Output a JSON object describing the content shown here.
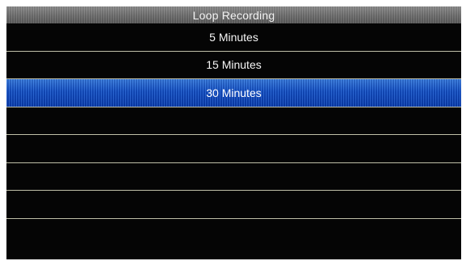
{
  "header": {
    "title": "Loop Recording"
  },
  "menu": {
    "items": [
      {
        "label": "5 Minutes",
        "selected": false
      },
      {
        "label": "15 Minutes",
        "selected": false
      },
      {
        "label": "30 Minutes",
        "selected": true
      },
      {
        "label": "",
        "selected": false
      },
      {
        "label": "",
        "selected": false
      },
      {
        "label": "",
        "selected": false
      },
      {
        "label": "",
        "selected": false
      },
      {
        "label": "",
        "selected": false
      }
    ]
  },
  "colors": {
    "background": "#050505",
    "title_bar": "#7a7a7a",
    "selection": "#1552c7",
    "divider": "#bfbfa8"
  }
}
